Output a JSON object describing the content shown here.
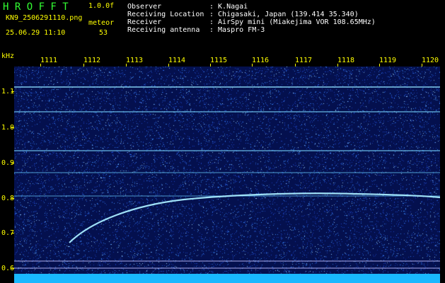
{
  "header": {
    "logo": "H R O F F T",
    "version": "1.0.0f",
    "filename": "KN9_2506291110.png",
    "meteor_label": "meteor",
    "meteor_count": "53",
    "datetime": "25.06.29 11:10",
    "info": [
      {
        "key": "Observer",
        "value": ": K.Nagai"
      },
      {
        "key": "Receiving Location",
        "value": ": Chigasaki, Japan (139.414 35.340)"
      },
      {
        "key": "Receiver",
        "value": ": AirSpy mini (Miakejima VOR 108.65MHz)"
      },
      {
        "key": "Receiving antenna",
        "value": ": Maspro FM-3"
      }
    ]
  },
  "axis": {
    "y_unit": "kHz",
    "x_ticks": [
      "1111",
      "1112",
      "1113",
      "1114",
      "1115",
      "1116",
      "1117",
      "1118",
      "1119",
      "1120"
    ],
    "y_ticks": [
      "1.1",
      "1.0",
      "0.9",
      "0.8",
      "0.7",
      "0.6"
    ]
  },
  "colors": {
    "background": "#000000",
    "spectrogram_base": "#04104e",
    "header_text": "#ffff00",
    "info_text": "#ffffff",
    "logo": "#33ff33",
    "echo_trace": "#9fe6ff"
  }
}
